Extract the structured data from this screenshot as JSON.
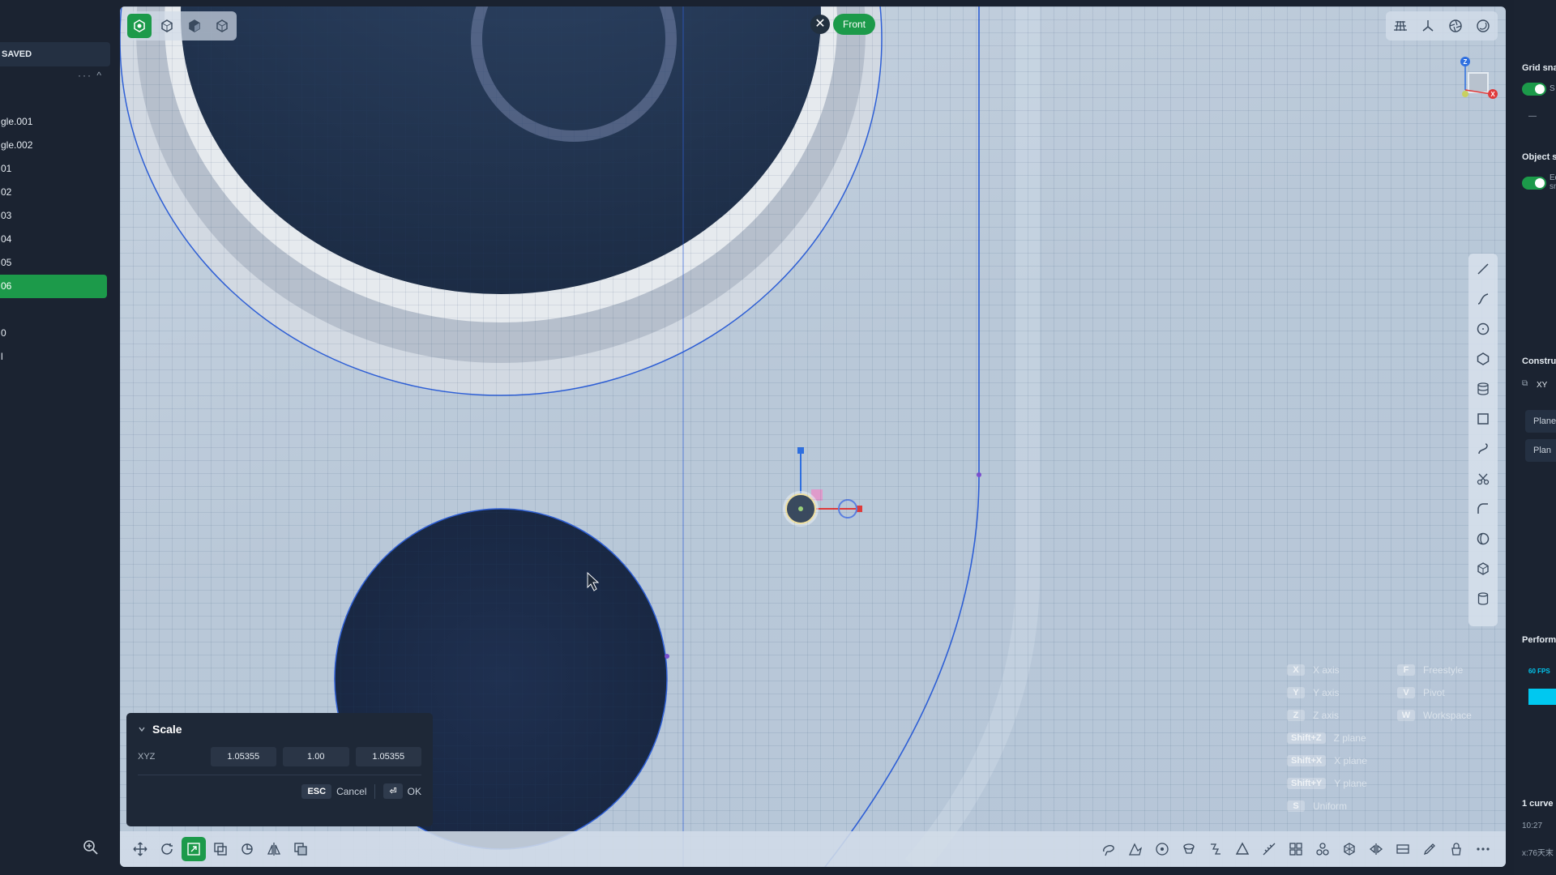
{
  "outliner": {
    "save_status": "SAVED",
    "controls": "··· ^",
    "objects": [
      {
        "label": "gle.001",
        "selected": false
      },
      {
        "label": "gle.002",
        "selected": false
      },
      {
        "label": "01",
        "selected": false
      },
      {
        "label": "02",
        "selected": false
      },
      {
        "label": "03",
        "selected": false
      },
      {
        "label": "04",
        "selected": false
      },
      {
        "label": "05",
        "selected": false
      },
      {
        "label": "06",
        "selected": true
      },
      {
        "label": "",
        "selected": false
      },
      {
        "label": "0",
        "selected": false
      },
      {
        "label": "l",
        "selected": false
      }
    ]
  },
  "viewport": {
    "view_name": "Front",
    "close_glyph": "✕"
  },
  "shortcuts": [
    {
      "key": "X",
      "label": "X axis"
    },
    {
      "key": "Y",
      "label": "Y axis"
    },
    {
      "key": "Z",
      "label": "Z axis"
    },
    {
      "key": "Shift+Z",
      "label": "Z plane"
    },
    {
      "key": "Shift+X",
      "label": "X plane"
    },
    {
      "key": "Shift+Y",
      "label": "Y plane"
    },
    {
      "key": "S",
      "label": "Uniform"
    },
    {
      "key": "F",
      "label": "Freestyle"
    },
    {
      "key": "V",
      "label": "Pivot"
    },
    {
      "key": "W",
      "label": "Workspace"
    }
  ],
  "scale_panel": {
    "title": "Scale",
    "axis_label": "XYZ",
    "x_value": "1.05355",
    "y_value": "1.00",
    "z_value": "1.05355",
    "esc_key": "ESC",
    "cancel_label": "Cancel",
    "ok_key": "⏎",
    "ok_label": "OK"
  },
  "right_panel": {
    "grid_snap_label": "Grid snap",
    "grid_snap_short": "S",
    "grid_snap_dash": "—",
    "object_snap_label": "Object sn",
    "object_snap_short": "Ed sn",
    "construct_label": "Constru",
    "construct_plane": "XY",
    "plane_btn_1": "Plane",
    "plane_btn_2": "Plan",
    "performance_label": "Performa",
    "fps_label": "60 FPS",
    "selection_info": "1 curve",
    "time_info": "10:27",
    "coord_info": "x:76天末"
  },
  "colors": {
    "accent": "#1c9a4a",
    "panel": "#1b2331",
    "curve": "#2e5fd6",
    "fps": "#00c8f0"
  }
}
